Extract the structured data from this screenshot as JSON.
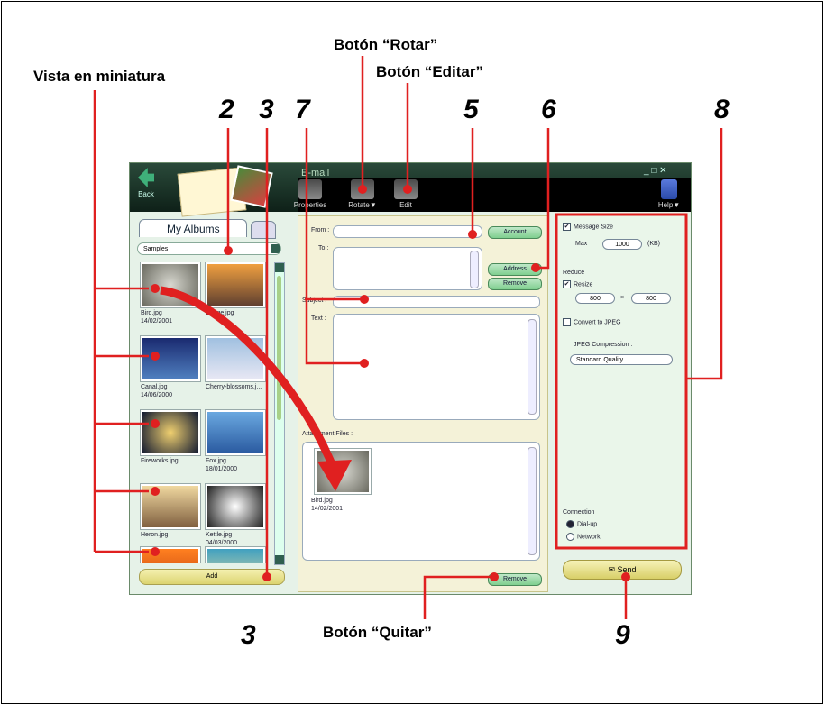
{
  "callouts": {
    "rotate": "Botón “Rotar”",
    "edit": "Botón “Editar”",
    "thumbnail": "Vista en miniatura",
    "remove": "Botón “Quitar”",
    "n2": "2",
    "n3a": "3",
    "n7": "7",
    "n5": "5",
    "n6": "6",
    "n8": "8",
    "n3b": "3",
    "n9": "9"
  },
  "window": {
    "title": "E-mail",
    "back": "Back",
    "help": "Help▼",
    "controls": "_ □ ✕",
    "toolbar": {
      "properties": "Properties",
      "rotate": "Rotate▼",
      "edit": "Edit"
    }
  },
  "left": {
    "tab": "My Albums",
    "album": "Samples",
    "thumbs": [
      {
        "name": "Bird.jpg",
        "date": "14/02/2001"
      },
      {
        "name": "Bridge.jpg",
        "date": ""
      },
      {
        "name": "Canal.jpg",
        "date": "14/06/2000"
      },
      {
        "name": "Cherry-blossoms.j...",
        "date": ""
      },
      {
        "name": "Fireworks.jpg",
        "date": ""
      },
      {
        "name": "Fox.jpg",
        "date": "18/01/2000"
      },
      {
        "name": "Heron.jpg",
        "date": ""
      },
      {
        "name": "Kettle.jpg",
        "date": "04/03/2000"
      }
    ],
    "add": "Add"
  },
  "center": {
    "from": "From :",
    "to": "To :",
    "subject": "Subject :",
    "text": "Text :",
    "attach": "Attachment Files :",
    "account": "Account",
    "address": "Address",
    "remove_to": "Remove",
    "remove_attach": "Remove",
    "attached": {
      "name": "Bird.jpg",
      "date": "14/02/2001"
    }
  },
  "right": {
    "message_size": "Message Size",
    "max": "Max",
    "max_value": "1000",
    "kb": "(KB)",
    "reduce": "Reduce",
    "resize": "Resize",
    "w": "800",
    "x": "×",
    "h": "800",
    "convert": "Convert to JPEG",
    "jpeg_comp": "JPEG Compression :",
    "quality": "Standard Quality",
    "connection": "Connection",
    "dialup": "Dial-up",
    "network": "Network",
    "send": "Send"
  },
  "colors": {
    "accent": "#e02020",
    "titlebar": "#0e2018",
    "panel": "#e6f2e8"
  }
}
